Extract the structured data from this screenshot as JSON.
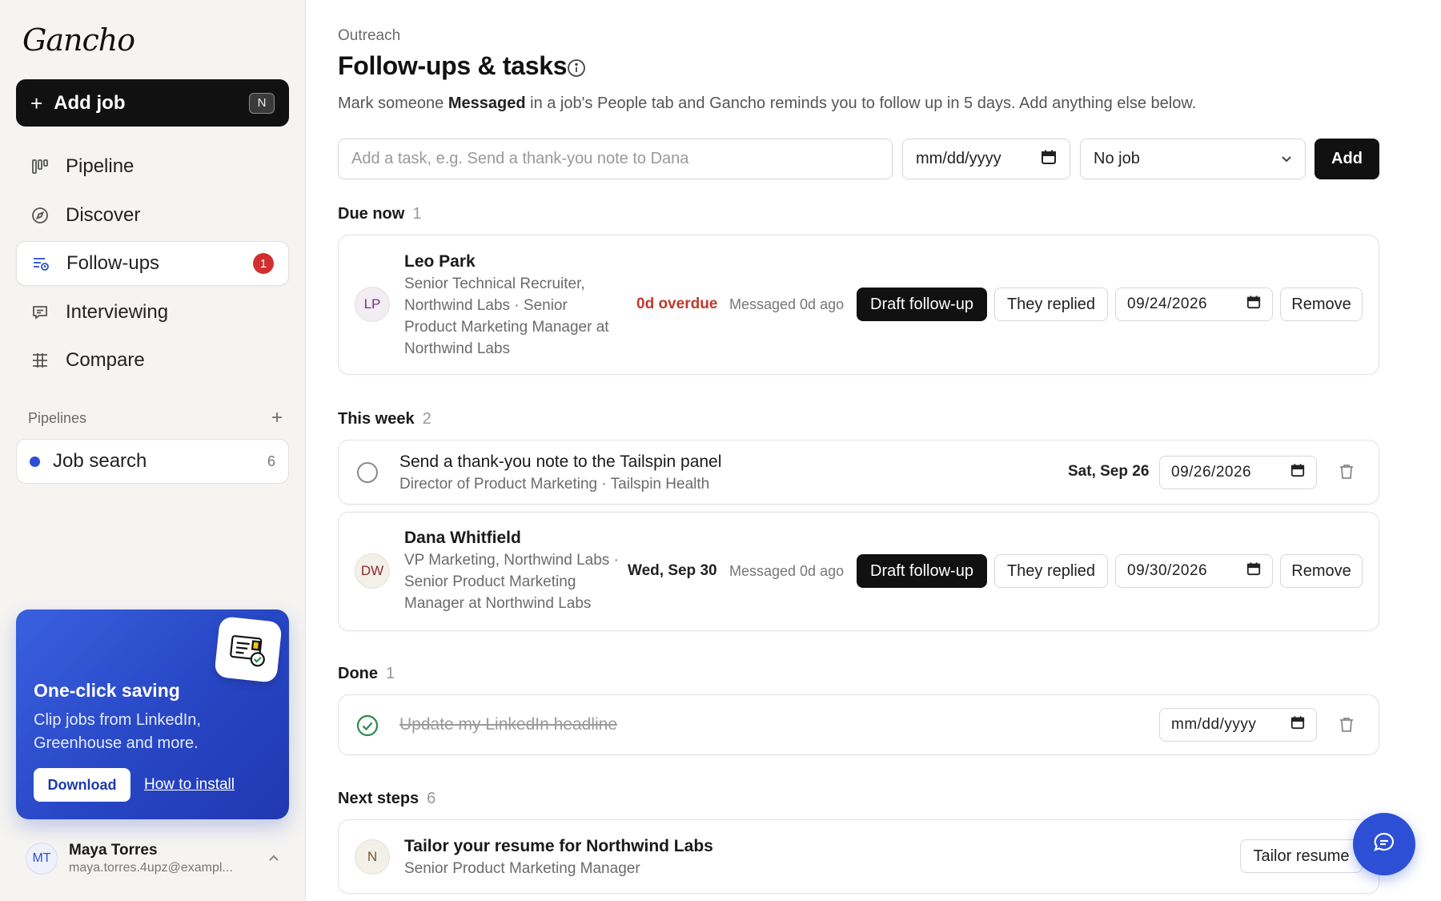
{
  "app": {
    "logo": "Gancho"
  },
  "sidebar": {
    "add_job": {
      "label": "Add job",
      "shortcut": "N"
    },
    "nav": [
      {
        "label": "Pipeline",
        "icon": "kanban-icon"
      },
      {
        "label": "Discover",
        "icon": "compass-icon"
      },
      {
        "label": "Follow-ups",
        "icon": "list-clock-icon",
        "badge": "1",
        "active": true
      },
      {
        "label": "Interviewing",
        "icon": "chat-bubble-icon"
      },
      {
        "label": "Compare",
        "icon": "table-icon"
      }
    ],
    "pipelines": {
      "heading": "Pipelines",
      "items": [
        {
          "label": "Job search",
          "count": "6",
          "color": "#2c4fd6"
        }
      ]
    },
    "promo": {
      "title": "One-click saving",
      "description": "Clip jobs from LinkedIn, Greenhouse and more.",
      "download_label": "Download",
      "install_label": "How to install"
    },
    "user": {
      "initials": "MT",
      "name": "Maya Torres",
      "email": "maya.torres.4upz@exampl..."
    }
  },
  "main": {
    "breadcrumb": "Outreach",
    "title": "Follow-ups & tasks",
    "subtitle_pre": "Mark someone ",
    "subtitle_bold": "Messaged",
    "subtitle_post": " in a job's People tab and Gancho reminds you to follow up in 5 days. Add anything else below.",
    "new_task": {
      "placeholder": "Add a task, e.g. Send a thank-you note to Dana",
      "date_placeholder": "mm/dd/yyyy",
      "job_select": "No job",
      "add_label": "Add"
    },
    "sections": {
      "due_now": {
        "label": "Due now",
        "count": "1"
      },
      "this_week": {
        "label": "This week",
        "count": "2"
      },
      "done": {
        "label": "Done",
        "count": "1"
      },
      "next_steps": {
        "label": "Next steps",
        "count": "6"
      }
    },
    "due_now_items": [
      {
        "initials": "LP",
        "name": "Leo Park",
        "detail": "Senior Technical Recruiter, Northwind Labs · Senior Product Marketing Manager at Northwind Labs",
        "status": "0d overdue",
        "messaged": "Messaged 0d ago",
        "draft_label": "Draft follow-up",
        "replied_label": "They replied",
        "date": "09/24/2026",
        "remove_label": "Remove"
      }
    ],
    "this_week_task": {
      "title": "Send a thank-you note to the Tailspin panel",
      "detail": "Director of Product Marketing · Tailspin Health",
      "due_label": "Sat, Sep 26",
      "date": "09/26/2026"
    },
    "this_week_person": {
      "initials": "DW",
      "name": "Dana Whitfield",
      "detail": "VP Marketing, Northwind Labs · Senior Product Marketing Manager at Northwind Labs",
      "due_label": "Wed, Sep 30",
      "messaged": "Messaged 0d ago",
      "draft_label": "Draft follow-up",
      "replied_label": "They replied",
      "date": "09/30/2026",
      "remove_label": "Remove"
    },
    "done_task": {
      "title": "Update my LinkedIn headline",
      "date": "mm/dd/yyyy"
    },
    "next_step": {
      "initials": "N",
      "title": "Tailor your resume for Northwind Labs",
      "detail": "Senior Product Marketing Manager",
      "action_label": "Tailor resume"
    }
  },
  "colors": {
    "accent": "#2c4fd6",
    "danger": "#c0392b",
    "badge": "#d32f2f",
    "dark": "#111111"
  }
}
